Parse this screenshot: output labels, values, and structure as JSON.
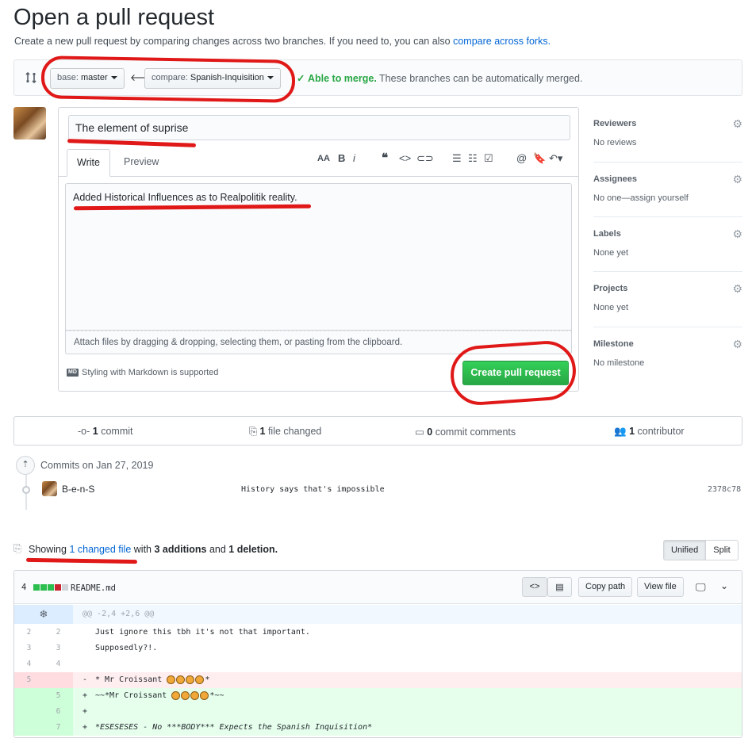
{
  "page": {
    "title": "Open a pull request",
    "subtitle": "Create a new pull request by comparing changes across two branches. If you need to, you can also",
    "subtitle_link": "compare across forks.",
    "accent_green": "#28a745",
    "link_color": "#0366d6",
    "annotation_color": "#e01818"
  },
  "compare": {
    "base_label": "base:",
    "base_value": "master",
    "compare_label": "compare:",
    "compare_value": "Spanish-Inquisition",
    "merge_ok": "Able to merge.",
    "merge_text": "These branches can be automatically merged."
  },
  "form": {
    "title_value": "The element of suprise",
    "tab_write": "Write",
    "tab_preview": "Preview",
    "body_value": "Added Historical Influences as to Realpolitik reality.",
    "attach_text": "Attach files by dragging & dropping, selecting them, or pasting from the clipboard.",
    "markdown_badge": "MD",
    "markdown_note": "Styling with Markdown is supported",
    "create_button": "Create pull request",
    "toolbar": [
      "header-icon",
      "bold-icon",
      "italic-icon",
      "quote-icon",
      "code-icon",
      "link-icon",
      "bullet-list-icon",
      "numbered-list-icon",
      "task-list-icon",
      "mention-icon",
      "bookmark-icon",
      "reply-icon"
    ]
  },
  "sidebar": [
    {
      "heading": "Reviewers",
      "value": "No reviews"
    },
    {
      "heading": "Assignees",
      "value": "No one—assign yourself"
    },
    {
      "heading": "Labels",
      "value": "None yet"
    },
    {
      "heading": "Projects",
      "value": "None yet"
    },
    {
      "heading": "Milestone",
      "value": "No milestone"
    }
  ],
  "stats": {
    "commits_n": "1",
    "commits_label": "commit",
    "files_n": "1",
    "files_label": "file changed",
    "comments_n": "0",
    "comments_label": "commit comments",
    "contributors_n": "1",
    "contributors_label": "contributor"
  },
  "commits": {
    "date_label": "Commits on Jan 27, 2019",
    "author": "B-e-n-S",
    "message": "History says that's impossible",
    "sha": "2378c78"
  },
  "files": {
    "showing": "Showing",
    "changed_link": "1 changed file",
    "with": "with",
    "additions": "3 additions",
    "and": "and",
    "deletions": "1 deletion.",
    "unified": "Unified",
    "split": "Split"
  },
  "diff": {
    "count": "4",
    "filename": "README.md",
    "copy_path": "Copy path",
    "view_file": "View file",
    "hunk": "@@ -2,4 +2,6 @@",
    "lines": [
      {
        "old": "2",
        "new": "2",
        "sign": " ",
        "text": "Just ignore this tbh it's not that important."
      },
      {
        "old": "3",
        "new": "3",
        "sign": " ",
        "text": "Supposedly?!."
      },
      {
        "old": "4",
        "new": "4",
        "sign": " ",
        "text": ""
      },
      {
        "old": "5",
        "new": "",
        "sign": "-",
        "text": "* Mr Croissant "
      },
      {
        "old": "",
        "new": "5",
        "sign": "+",
        "text": "~~*Mr Croissant "
      },
      {
        "old": "",
        "new": "6",
        "sign": "+",
        "text": ""
      },
      {
        "old": "",
        "new": "7",
        "sign": "+",
        "text": "*ESESESES - No ***BODY*** Expects the Spanish Inquisition*"
      }
    ]
  }
}
